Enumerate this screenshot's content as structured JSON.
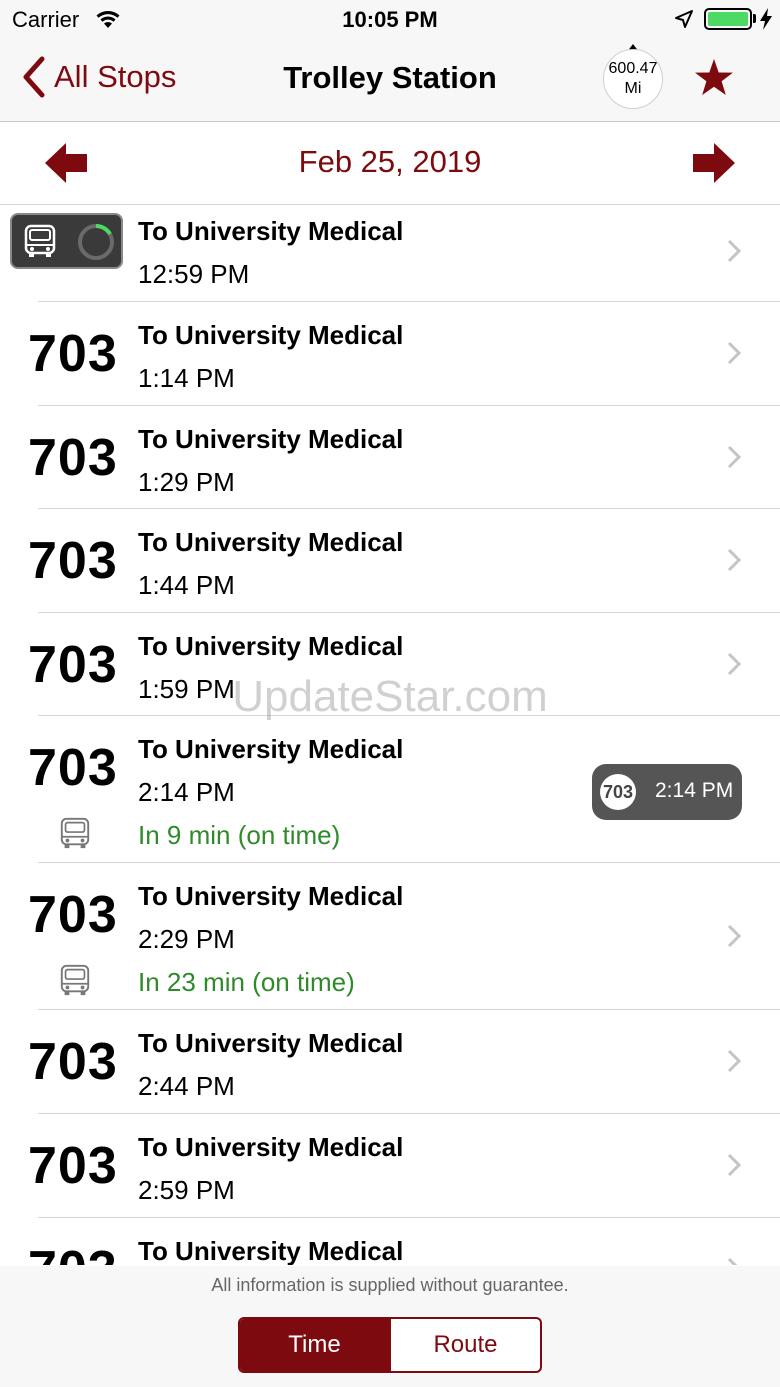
{
  "status_bar": {
    "carrier": "Carrier",
    "time": "10:05 PM"
  },
  "nav": {
    "back_label": "All Stops",
    "title": "Trolley Station",
    "distance_value": "600.47",
    "distance_unit": "Mi"
  },
  "date_bar": {
    "date": "Feb 25, 2019"
  },
  "departures": [
    {
      "route": "",
      "destination": "To University Medical",
      "time": "12:59 PM",
      "realtime": ""
    },
    {
      "route": "703",
      "destination": "To University Medical",
      "time": "1:14 PM",
      "realtime": ""
    },
    {
      "route": "703",
      "destination": "To University Medical",
      "time": "1:29 PM",
      "realtime": ""
    },
    {
      "route": "703",
      "destination": "To University Medical",
      "time": "1:44 PM",
      "realtime": ""
    },
    {
      "route": "703",
      "destination": "To University Medical",
      "time": "1:59 PM",
      "realtime": ""
    },
    {
      "route": "703",
      "destination": "To University Medical",
      "time": "2:14 PM",
      "realtime": "In 9 min (on time)",
      "badge_route": "703",
      "badge_time": "2:14 PM"
    },
    {
      "route": "703",
      "destination": "To University Medical",
      "time": "2:29 PM",
      "realtime": "In 23 min (on time)"
    },
    {
      "route": "703",
      "destination": "To University Medical",
      "time": "2:44 PM",
      "realtime": ""
    },
    {
      "route": "703",
      "destination": "To University Medical",
      "time": "2:59 PM",
      "realtime": ""
    },
    {
      "route": "703",
      "destination": "To University Medical",
      "time": "",
      "realtime": ""
    }
  ],
  "watermark": "UpdateStar.com",
  "footer": {
    "disclaimer": "All information is supplied without guarantee.",
    "segments": [
      "Time",
      "Route"
    ]
  },
  "colors": {
    "accent": "#7d0a0f",
    "realtime_green": "#2f8a2a",
    "battery": "#4cd964"
  },
  "icons": [
    "wifi-icon",
    "location-arrow-icon",
    "battery-icon",
    "charging-bolt-icon",
    "back-chevron-icon",
    "compass-pointer-icon",
    "star-icon",
    "arrow-left-icon",
    "arrow-right-icon",
    "bus-icon",
    "loading-spinner-icon",
    "chevron-right-icon"
  ]
}
